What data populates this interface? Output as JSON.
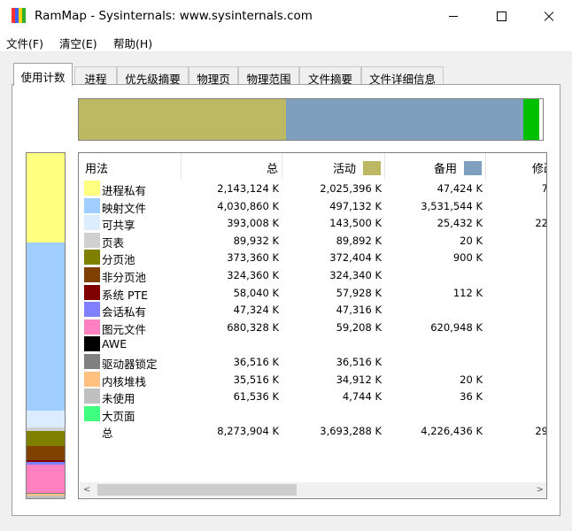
{
  "window": {
    "title": "RamMap - Sysinternals: www.sysinternals.com",
    "icon_colors": [
      "#ff3030",
      "#3f5fff",
      "#ffd200",
      "#30b030"
    ]
  },
  "menu": [
    {
      "name": "menu-file",
      "label": "文件(F)"
    },
    {
      "name": "menu-clear",
      "label": "清空(E)"
    },
    {
      "name": "menu-help",
      "label": "帮助(H)"
    }
  ],
  "tabs": [
    {
      "label": "使用计数",
      "active": true
    },
    {
      "label": "进程"
    },
    {
      "label": "优先级摘要"
    },
    {
      "label": "物理页"
    },
    {
      "label": "物理范围"
    },
    {
      "label": "文件摘要"
    },
    {
      "label": "文件详细信息"
    }
  ],
  "colors": {
    "active": "#bdb864",
    "standby": "#7f9fbf",
    "modified": "#00c000"
  },
  "usage_bar": {
    "active_fraction": 0.447,
    "standby_fraction": 0.511,
    "modified_fraction": 0.035
  },
  "columns": {
    "usage": "用法",
    "total": "总",
    "active": "活动",
    "standby": "备用",
    "modified": "修改"
  },
  "rows": [
    {
      "label": "进程私有",
      "color": "#ffff80",
      "total": "2,143,124 K",
      "active": "2,025,396 K",
      "standby": "47,424 K",
      "modified": "7"
    },
    {
      "label": "映射文件",
      "color": "#a0cfff",
      "total": "4,030,860 K",
      "active": "497,132 K",
      "standby": "3,531,544 K",
      "modified": ""
    },
    {
      "label": "可共享",
      "color": "#dcecff",
      "total": "393,008 K",
      "active": "143,500 K",
      "standby": "25,432 K",
      "modified": "22"
    },
    {
      "label": "页表",
      "color": "#d0d0d0",
      "total": "89,932 K",
      "active": "89,892 K",
      "standby": "20 K",
      "modified": ""
    },
    {
      "label": "分页池",
      "color": "#808000",
      "total": "373,360 K",
      "active": "372,404 K",
      "standby": "900 K",
      "modified": ""
    },
    {
      "label": "非分页池",
      "color": "#804000",
      "total": "324,360 K",
      "active": "324,340 K",
      "standby": "",
      "modified": ""
    },
    {
      "label": "系统 PTE",
      "color": "#800000",
      "total": "58,040 K",
      "active": "57,928 K",
      "standby": "112 K",
      "modified": ""
    },
    {
      "label": "会话私有",
      "color": "#8080ff",
      "total": "47,324 K",
      "active": "47,316 K",
      "standby": "",
      "modified": ""
    },
    {
      "label": "图元文件",
      "color": "#ff80c0",
      "total": "680,328 K",
      "active": "59,208 K",
      "standby": "620,948 K",
      "modified": ""
    },
    {
      "label": "AWE",
      "color": "#000000",
      "total": "",
      "active": "",
      "standby": "",
      "modified": ""
    },
    {
      "label": "驱动器锁定",
      "color": "#808080",
      "total": "36,516 K",
      "active": "36,516 K",
      "standby": "",
      "modified": ""
    },
    {
      "label": "内核堆栈",
      "color": "#ffc080",
      "total": "35,516 K",
      "active": "34,912 K",
      "standby": "20 K",
      "modified": ""
    },
    {
      "label": "未使用",
      "color": "#c0c0c0",
      "total": "61,536 K",
      "active": "4,744 K",
      "standby": "36 K",
      "modified": ""
    },
    {
      "label": "大页面",
      "color": "#40ff80",
      "total": "",
      "active": "",
      "standby": "",
      "modified": ""
    },
    {
      "label": "总",
      "color": "",
      "total": "8,273,904 K",
      "active": "3,693,288 K",
      "standby": "4,226,436 K",
      "modified": "29"
    }
  ],
  "scrollbar": {
    "left_arrow": "<",
    "right_arrow": ">"
  }
}
